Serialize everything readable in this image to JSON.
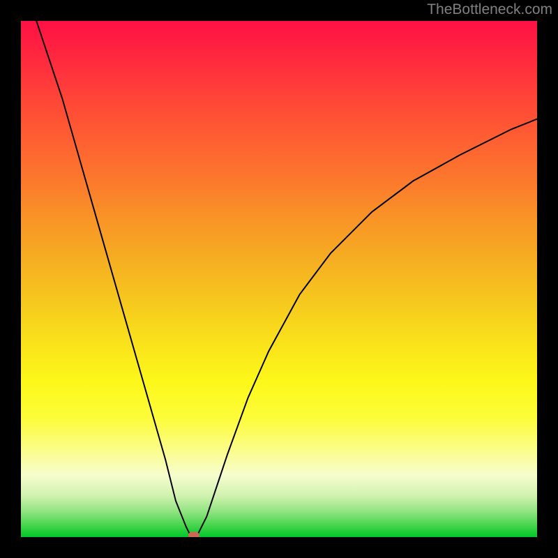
{
  "watermark": "TheBottleneck.com",
  "chart_data": {
    "type": "line",
    "title": "",
    "xlabel": "",
    "ylabel": "",
    "xlim": [
      0,
      100
    ],
    "ylim": [
      0,
      100
    ],
    "gradient_background": {
      "top_color": "#ff1144",
      "bottom_color": "#00c82a",
      "description": "red-orange-yellow-green vertical gradient (bottleneck severity)"
    },
    "series": [
      {
        "name": "left-branch",
        "x": [
          3,
          8,
          12,
          16,
          20,
          24,
          28,
          30,
          32,
          33
        ],
        "y": [
          100,
          85,
          71,
          57,
          43,
          29,
          15,
          7,
          2,
          0
        ]
      },
      {
        "name": "right-branch",
        "x": [
          34,
          36,
          38,
          40,
          44,
          48,
          54,
          60,
          68,
          76,
          85,
          95,
          100
        ],
        "y": [
          0,
          4,
          10,
          16,
          27,
          36,
          47,
          55,
          63,
          69,
          74,
          79,
          81
        ]
      }
    ],
    "marker": {
      "x": 33.5,
      "y": 0,
      "color": "#cc6655",
      "shape": "rounded-rect"
    }
  }
}
